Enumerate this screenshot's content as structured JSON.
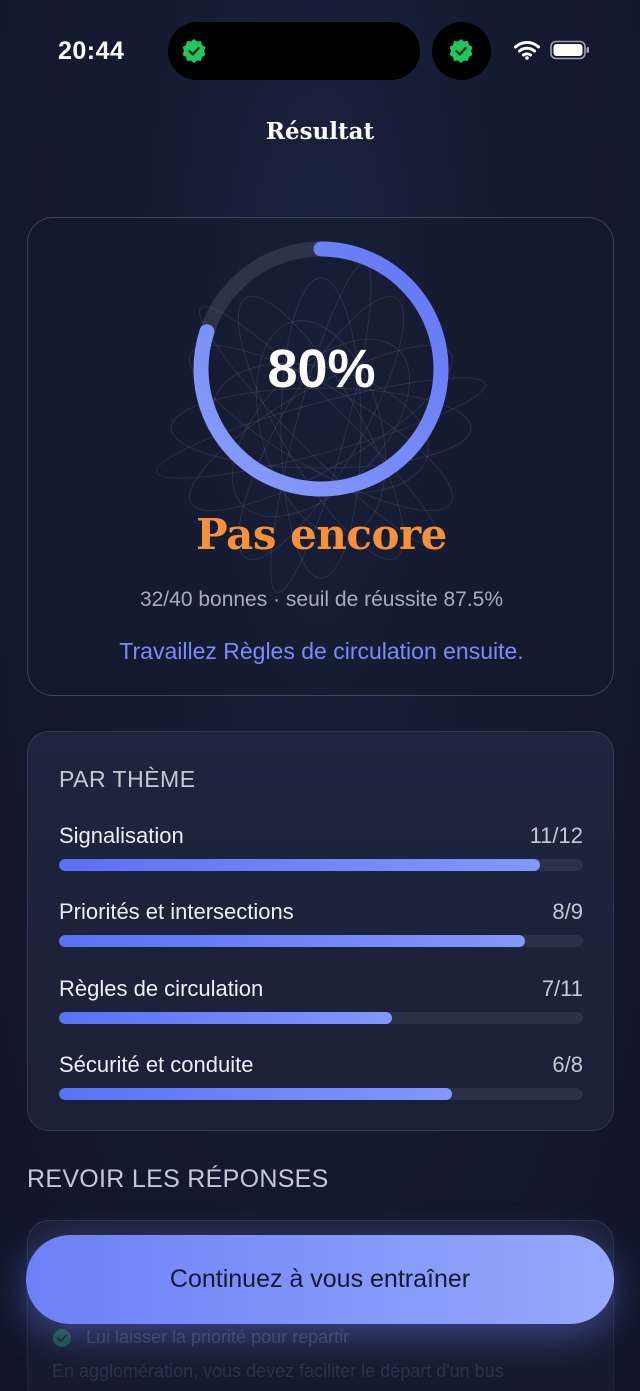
{
  "status_bar": {
    "time": "20:44",
    "icons": [
      "verified-badge-icon",
      "wifi-icon",
      "battery-icon"
    ]
  },
  "header": {
    "title": "Résultat"
  },
  "result": {
    "percent_label": "80%",
    "progress": 0.8,
    "verdict": "Pas encore",
    "score_line": "32/40 bonnes · seuil de réussite 87.5%",
    "advice": "Travaillez Règles de circulation ensuite."
  },
  "themes": {
    "heading": "PAR THÈME",
    "items": [
      {
        "name": "Signalisation",
        "score": "11/12",
        "fraction": 0.917
      },
      {
        "name": "Priorités et intersections",
        "score": "8/9",
        "fraction": 0.889
      },
      {
        "name": "Règles de circulation",
        "score": "7/11",
        "fraction": 0.636
      },
      {
        "name": "Sécurité et conduite",
        "score": "6/8",
        "fraction": 0.75
      }
    ]
  },
  "review": {
    "heading": "REVOIR LES RÉPONSES",
    "first_question": "Lui laisser la priorité pour repartir",
    "first_explanation": "En agglomération, vous devez faciliter le départ d'un bus"
  },
  "cta": {
    "label": "Continuez à vous entraîner"
  },
  "colors": {
    "accent": "#7c8bf7",
    "verdict": "#f5913a",
    "success_badge": "#22c55e",
    "background": "#141a30"
  }
}
